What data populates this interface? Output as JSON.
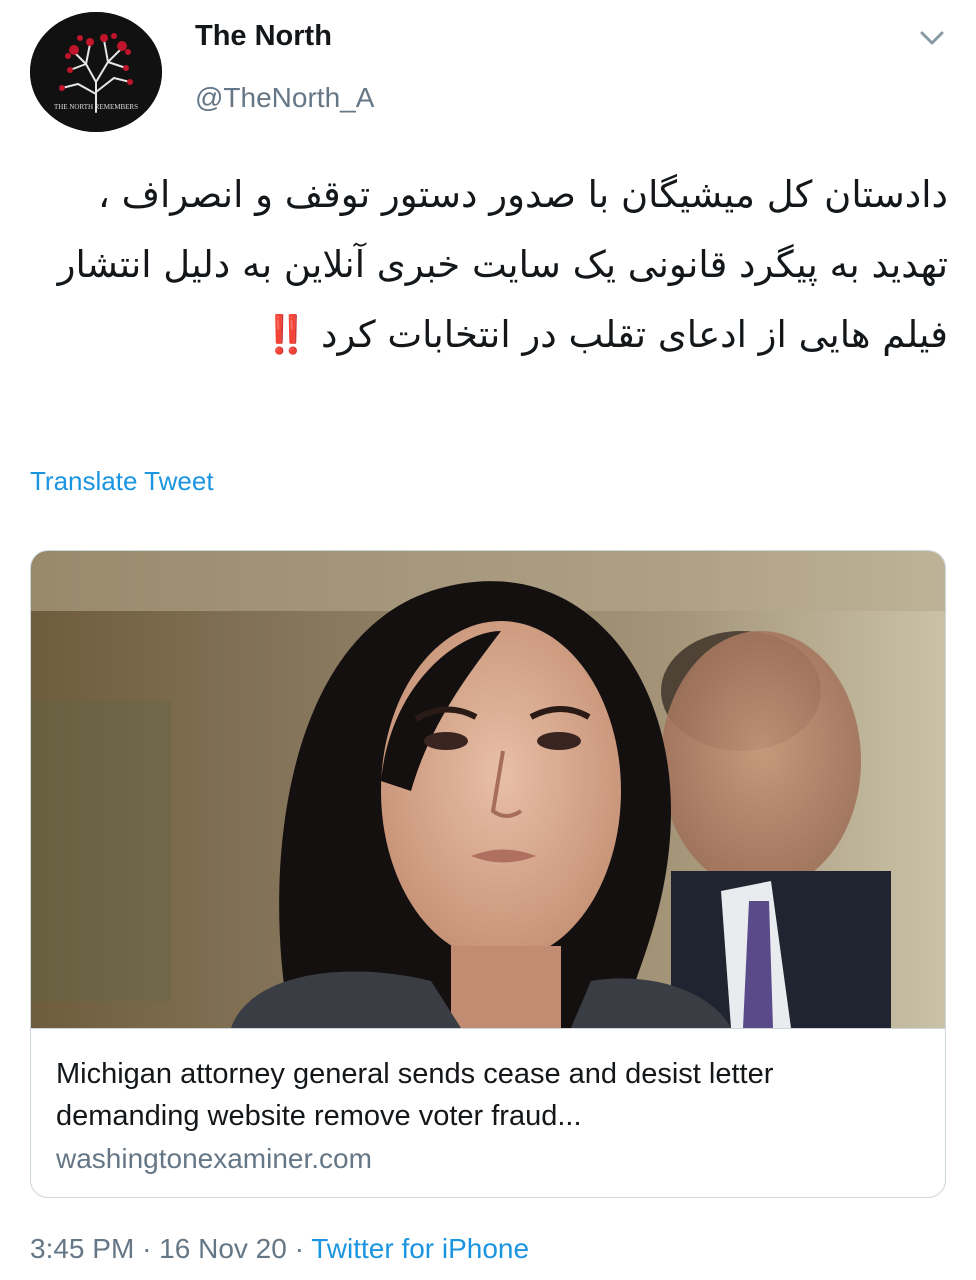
{
  "author": {
    "display_name": "The North",
    "handle": "@TheNorth_A",
    "avatar_text": "THE NORTH REMEMBERS"
  },
  "tweet": {
    "text": "دادستان کل میشیگان با صدور دستور توقف و انصراف ، تهدید به پیگرد قانونی یک سایت خبری آنلاین به دلیل انتشار فیلم هایی از ادعای تقلب در انتخابات کرد",
    "emoji": "‼️",
    "translate_label": "Translate Tweet"
  },
  "card": {
    "title": "Michigan attorney general sends cease and desist letter demanding website remove voter fraud...",
    "domain": "washingtonexaminer.com"
  },
  "meta": {
    "time": "3:45 PM",
    "date": "16 Nov 20",
    "separator": "·",
    "source": "Twitter for iPhone"
  },
  "colors": {
    "link": "#1b95e0",
    "secondary_text": "#657786",
    "border": "#ccd6dd",
    "emoji_red": "#d8213b"
  },
  "icons": {
    "menu": "chevron-down-icon"
  }
}
